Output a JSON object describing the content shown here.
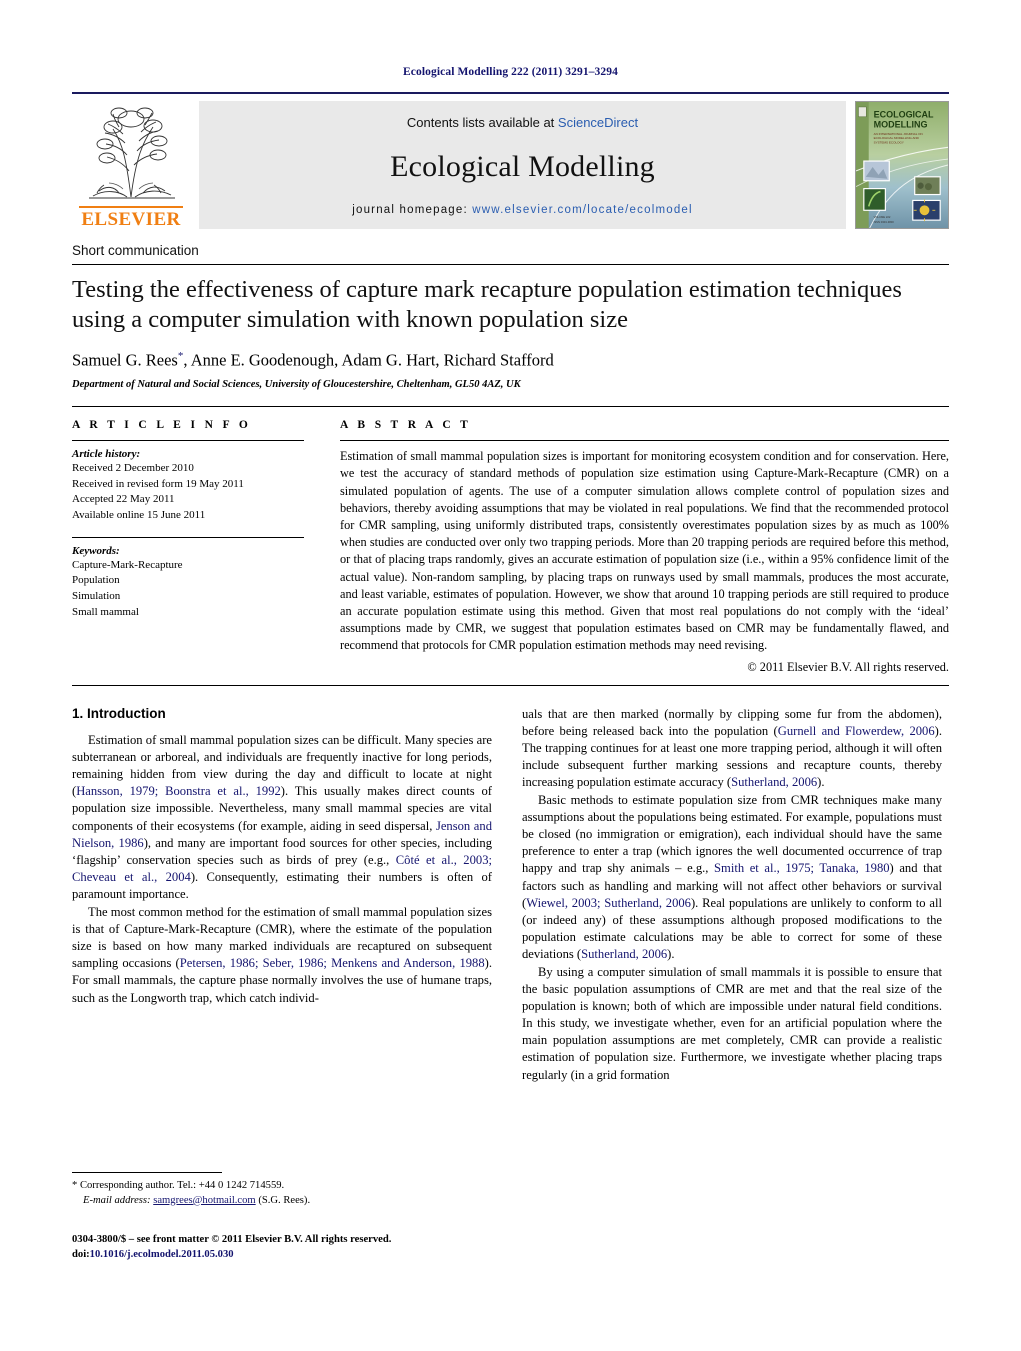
{
  "running_head": "Ecological Modelling 222 (2011) 3291–3294",
  "masthead": {
    "contents_prefix": "Contents lists available at ",
    "sciencedirect": "ScienceDirect",
    "journal_title": "Ecological Modelling",
    "homepage_prefix": "journal homepage: ",
    "homepage_url": "www.elsevier.com/locate/ecolmodel",
    "publisher_wordmark": "ELSEVIER",
    "cover_title_line1": "ECOLOGICAL",
    "cover_title_line2": "MODELLING",
    "cover_subtitle": "AN INTERNATIONAL JOURNAL ON ECOLOGICAL MODELLING AND SYSTEMS ECOLOGY",
    "accent_blue": "#2a5db0",
    "accent_orange": "#f07f13",
    "band_gray": "#e9e9e9"
  },
  "article": {
    "type": "Short communication",
    "title": "Testing the effectiveness of capture mark recapture population estimation techniques using a computer simulation with known population size",
    "authors": "Samuel G. Rees",
    "authors_rest": ", Anne E. Goodenough, Adam G. Hart, Richard Stafford",
    "corresponding_marker": "*",
    "affiliation": "Department of Natural and Social Sciences, University of Gloucestershire, Cheltenham, GL50 4AZ, UK"
  },
  "article_info": {
    "heading": "A R T I C L E    I N F O",
    "history_label": "Article history:",
    "history": [
      "Received 2 December 2010",
      "Received in revised form 19 May 2011",
      "Accepted 22 May 2011",
      "Available online 15 June 2011"
    ],
    "keywords_label": "Keywords:",
    "keywords": [
      "Capture-Mark-Recapture",
      "Population",
      "Simulation",
      "Small mammal"
    ]
  },
  "abstract": {
    "heading": "A B S T R A C T",
    "text": "Estimation of small mammal population sizes is important for monitoring ecosystem condition and for conservation. Here, we test the accuracy of standard methods of population size estimation using Capture-Mark-Recapture (CMR) on a simulated population of agents. The use of a computer simulation allows complete control of population sizes and behaviors, thereby avoiding assumptions that may be violated in real populations. We find that the recommended protocol for CMR sampling, using uniformly distributed traps, consistently overestimates population sizes by as much as 100% when studies are conducted over only two trapping periods. More than 20 trapping periods are required before this method, or that of placing traps randomly, gives an accurate estimation of population size (i.e., within a 95% confidence limit of the actual value). Non-random sampling, by placing traps on runways used by small mammals, produces the most accurate, and least variable, estimates of population. However, we show that around 10 trapping periods are still required to produce an accurate population estimate using this method. Given that most real populations do not comply with the ‘ideal’ assumptions made by CMR, we suggest that population estimates based on CMR may be fundamentally flawed, and recommend that protocols for CMR population estimation methods may need revising.",
    "copyright": "© 2011 Elsevier B.V. All rights reserved."
  },
  "body": {
    "section_number_title": "1.  Introduction",
    "left_paragraph_1_a": "Estimation of small mammal population sizes can be difficult. Many species are subterranean or arboreal, and individuals are frequently inactive for long periods, remaining hidden from view during the day and difficult to locate at night (",
    "left_cite_1": "Hansson, 1979; Boonstra et al., 1992",
    "left_paragraph_1_b": "). This usually makes direct counts of population size impossible. Nevertheless, many small mammal species are vital components of their ecosystems (for example, aiding in seed dispersal, ",
    "left_cite_2": "Jenson and Nielson, 1986",
    "left_paragraph_1_c": "), and many are important food sources for other species, including ‘flagship’ conservation species such as birds of prey (e.g., ",
    "left_cite_3": "Côté et al., 2003; Cheveau et al., 2004",
    "left_paragraph_1_d": "). Consequently, estimating their numbers is often of paramount importance.",
    "left_paragraph_2_a": "The most common method for the estimation of small mammal population sizes is that of Capture-Mark-Recapture (CMR), where the estimate of the population size is based on how many marked individuals are recaptured on subsequent sampling occasions (",
    "left_cite_4": "Petersen, 1986; Seber, 1986; Menkens and Anderson, 1988",
    "left_paragraph_2_b": "). For small mammals, the capture phase normally involves the use of humane traps, such as the Longworth trap, which catch individ-",
    "right_paragraph_1_a": "uals that are then marked (normally by clipping some fur from the abdomen), before being released back into the population (",
    "right_cite_1": "Gurnell and Flowerdew, 2006",
    "right_paragraph_1_b": "). The trapping continues for at least one more trapping period, although it will often include subsequent further marking sessions and recapture counts, thereby increasing population estimate accuracy (",
    "right_cite_2": "Sutherland, 2006",
    "right_paragraph_1_c": ").",
    "right_paragraph_2_a": "Basic methods to estimate population size from CMR techniques make many assumptions about the populations being estimated. For example, populations must be closed (no immigration or emigration), each individual should have the same preference to enter a trap (which ignores the well documented occurrence of trap happy and trap shy animals – e.g., ",
    "right_cite_3": "Smith et al., 1975; Tanaka, 1980",
    "right_paragraph_2_b": ") and that factors such as handling and marking will not affect other behaviors or survival (",
    "right_cite_4": "Wiewel, 2003; Sutherland, 2006",
    "right_paragraph_2_c": "). Real populations are unlikely to conform to all (or indeed any) of these assumptions although proposed modifications to the population estimate calculations may be able to correct for some of these deviations (",
    "right_cite_5": "Sutherland, 2006",
    "right_paragraph_2_d": ").",
    "right_paragraph_3": "By using a computer simulation of small mammals it is possible to ensure that the basic population assumptions of CMR are met and that the real size of the population is known; both of which are impossible under natural field conditions. In this study, we investigate whether, even for an artificial population where the main population assumptions are met completely, CMR can provide a realistic estimation of population size. Furthermore, we investigate whether placing traps regularly (in a grid formation"
  },
  "footnote": {
    "marker": "*",
    "corresponding_text": " Corresponding author. Tel.: +44 0 1242 714559.",
    "email_label": "E-mail address:",
    "email": "samgrees@hotmail.com",
    "email_suffix": " (S.G. Rees)."
  },
  "imprint": {
    "issn_line": "0304-3800/$ – see front matter © 2011 Elsevier B.V. All rights reserved.",
    "doi_label": "doi:",
    "doi_value": "10.1016/j.ecolmodel.2011.05.030"
  }
}
